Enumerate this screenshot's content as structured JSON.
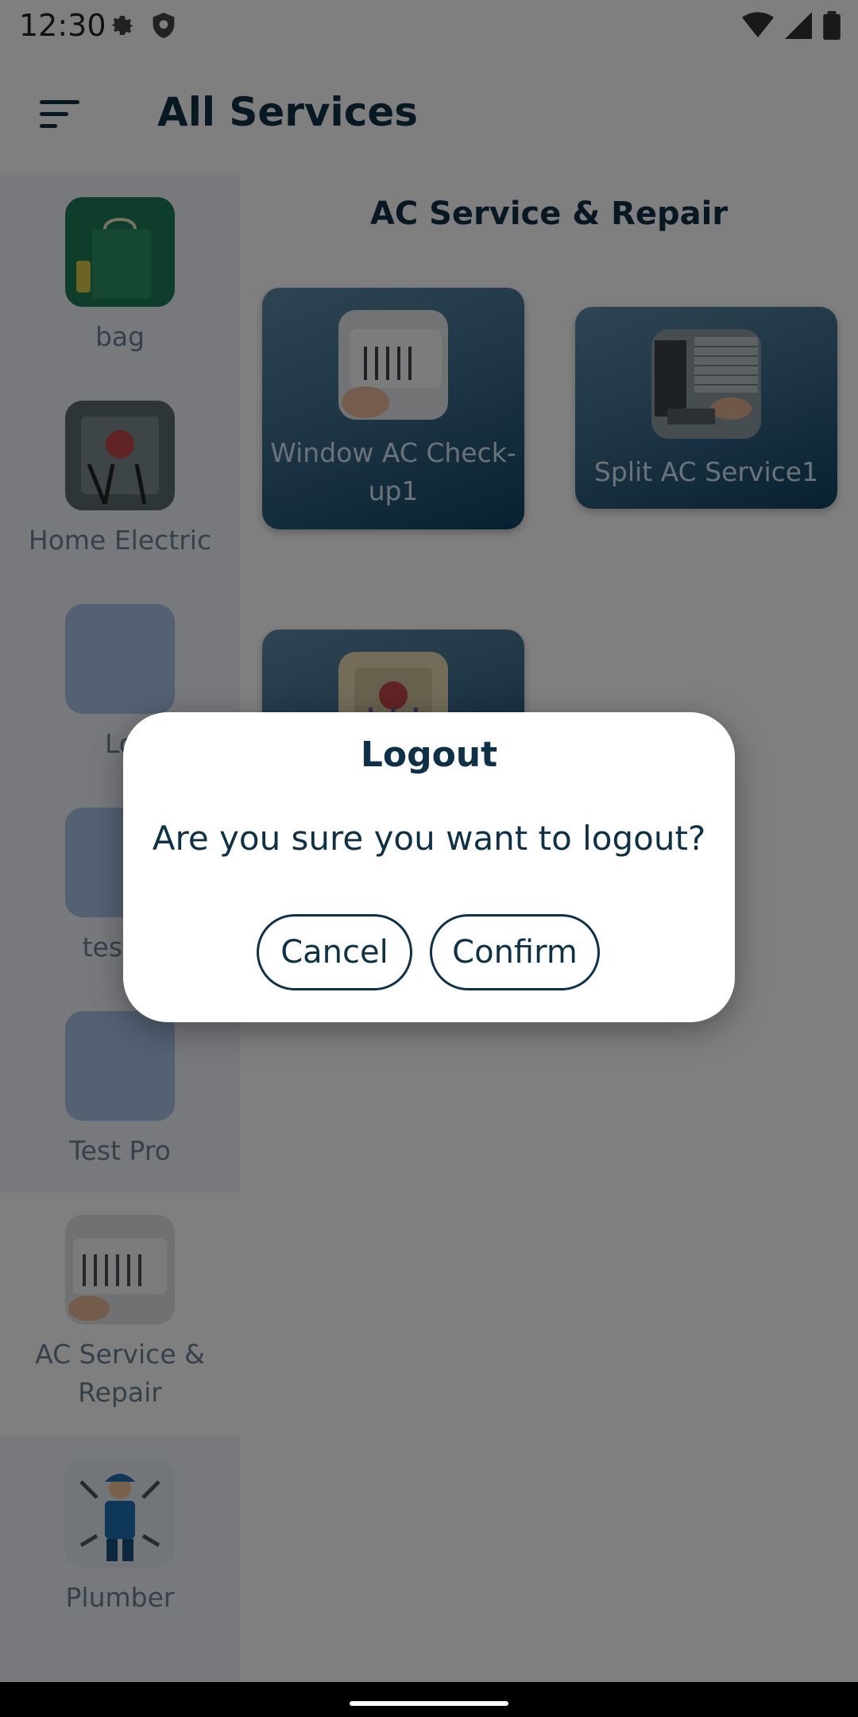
{
  "status_bar": {
    "time": "12:30"
  },
  "header": {
    "title": "All Services"
  },
  "sidebar": {
    "items": [
      {
        "label": "bag",
        "icon": "bag-image"
      },
      {
        "label": "Home Electric",
        "icon": "electric-panel-image"
      },
      {
        "label": "Lo",
        "icon": "placeholder-image"
      },
      {
        "label": "test p",
        "icon": "placeholder-image"
      },
      {
        "label": "Test Pro",
        "icon": "placeholder-image"
      },
      {
        "label": "AC Service & Repair",
        "icon": "ac-unit-image",
        "selected": true
      },
      {
        "label": "Plumber",
        "icon": "plumber-image"
      }
    ]
  },
  "main": {
    "section_title": "AC Service & Repair",
    "services": [
      {
        "label": "Window AC Check-up1",
        "icon": "window-ac-image"
      },
      {
        "label": "Split AC Service1",
        "icon": "split-ac-image"
      },
      {
        "label": "",
        "icon": "ac-repair-image"
      }
    ]
  },
  "dialog": {
    "title": "Logout",
    "message": "Are you sure you want to logout?",
    "cancel_label": "Cancel",
    "confirm_label": "Confirm"
  },
  "colors": {
    "primary": "#0e3147",
    "sidebar_bg": "#eef3fa",
    "card_gradient_start": "#5e8aa6",
    "card_gradient_end": "#0f4363",
    "scrim": "rgba(0,0,0,0.5)"
  }
}
